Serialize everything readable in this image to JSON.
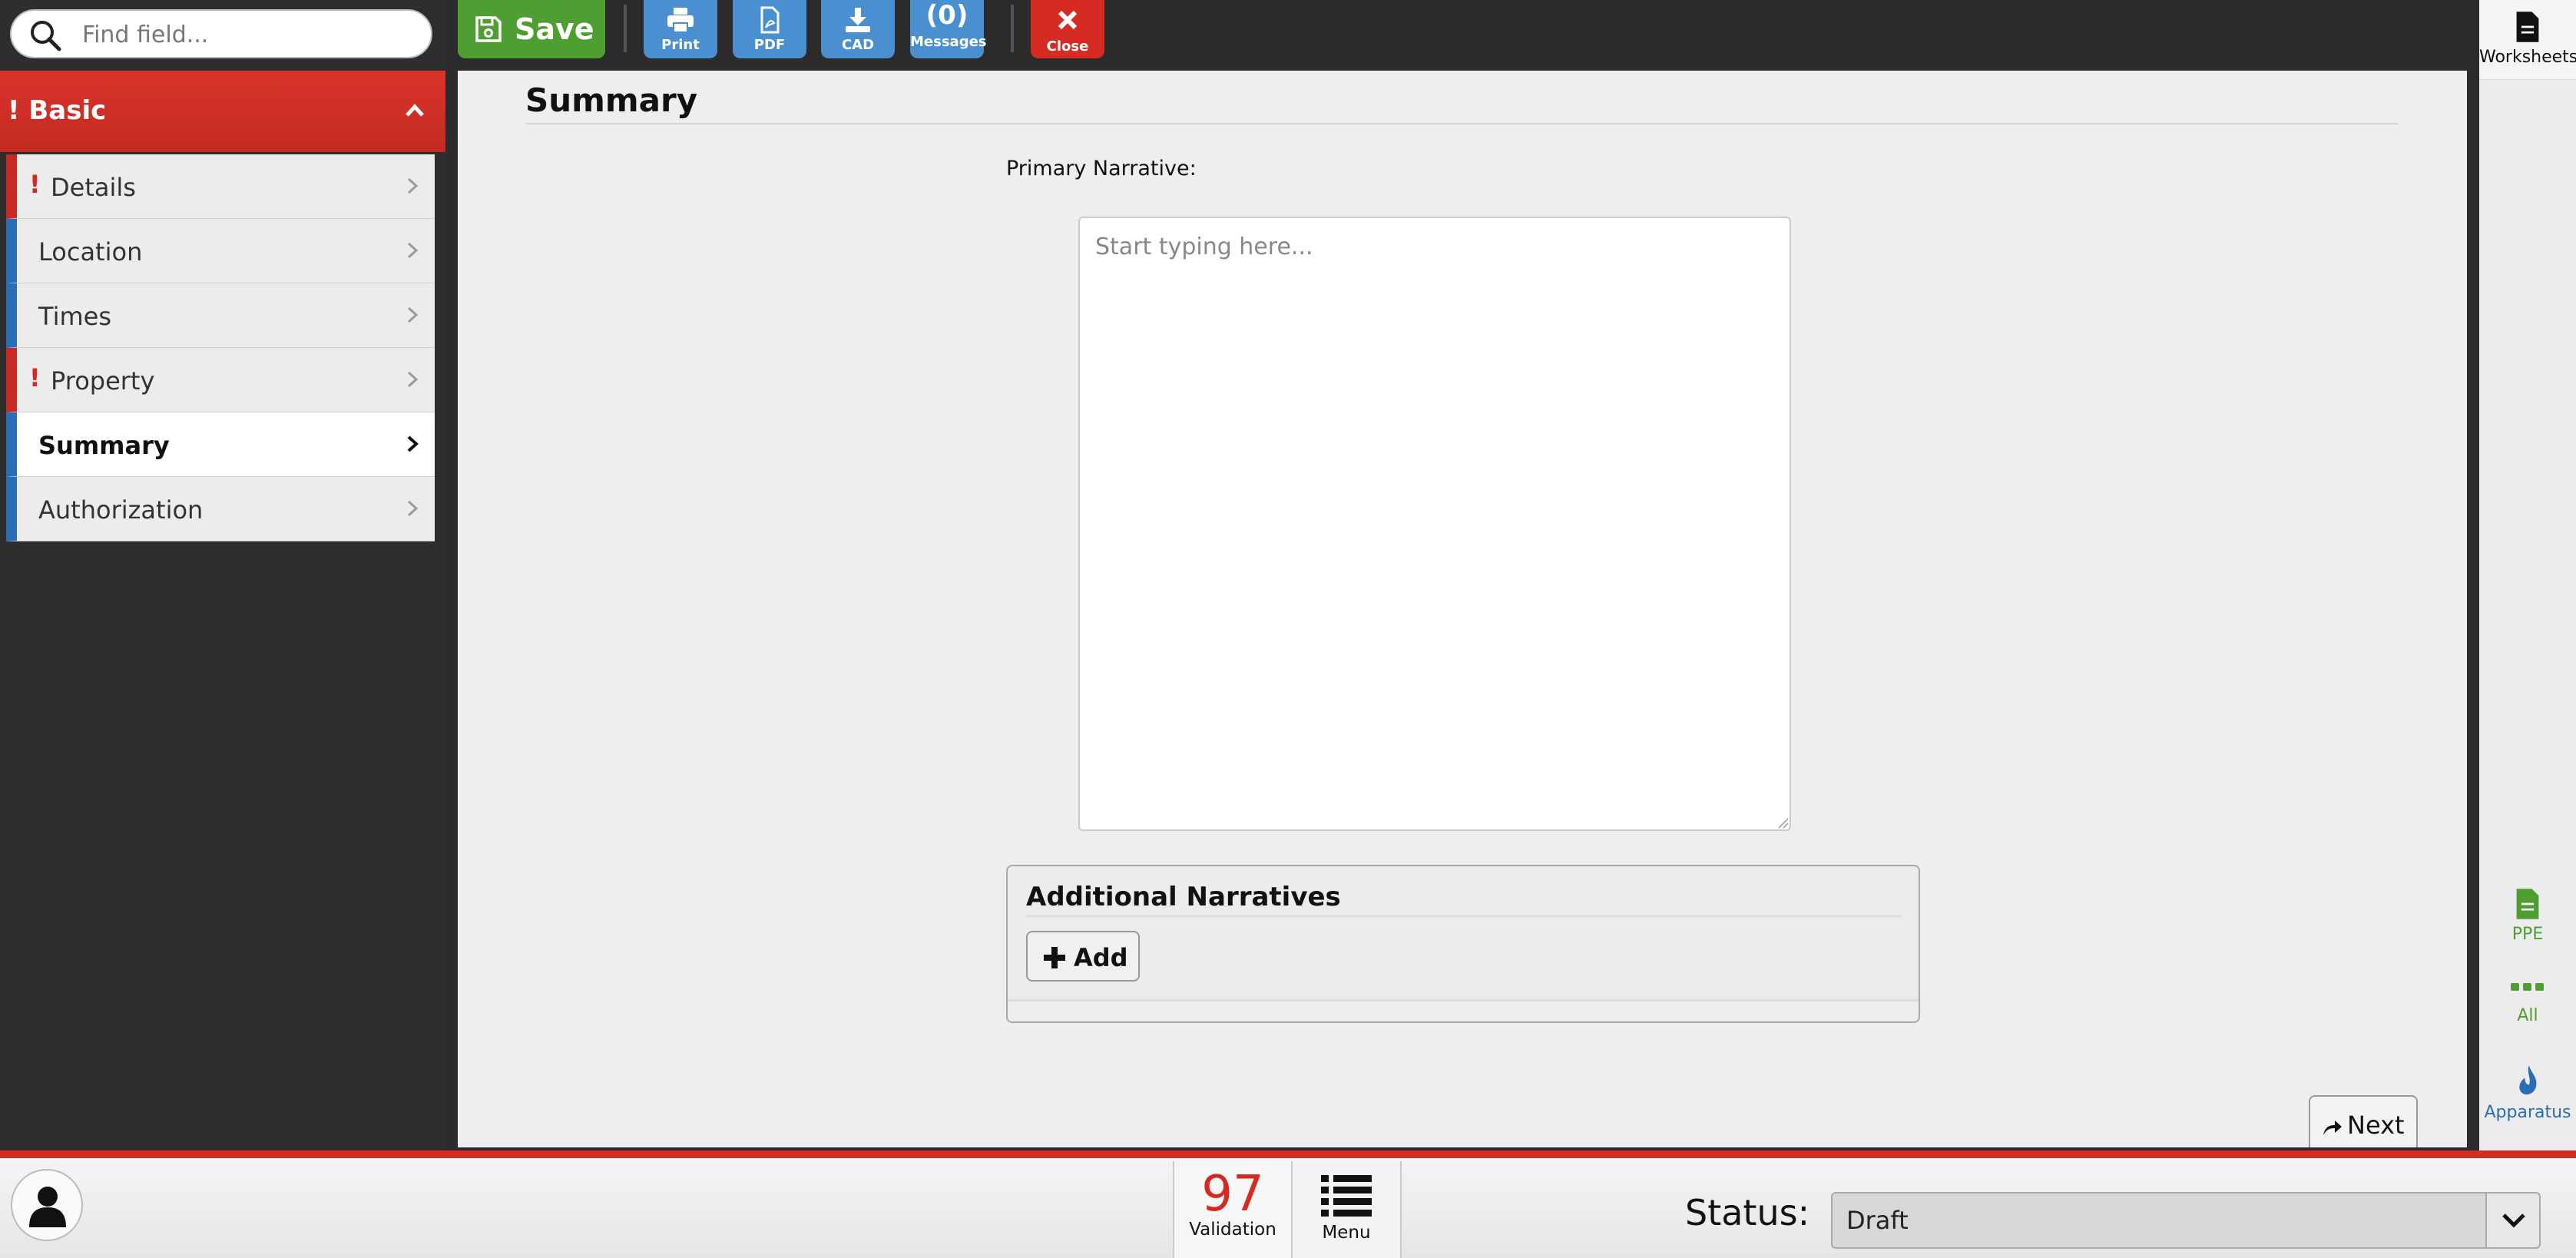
{
  "search": {
    "placeholder": "Find field..."
  },
  "section": {
    "title": "! Basic"
  },
  "nav": {
    "items": [
      {
        "label": "Details",
        "warning": true,
        "active": false
      },
      {
        "label": "Location",
        "warning": false,
        "active": false
      },
      {
        "label": "Times",
        "warning": false,
        "active": false
      },
      {
        "label": "Property",
        "warning": true,
        "active": false
      },
      {
        "label": "Summary",
        "warning": false,
        "active": true
      },
      {
        "label": "Authorization",
        "warning": false,
        "active": false
      }
    ],
    "warning_mark": "!"
  },
  "toolbar": {
    "save_label": "Save",
    "print_label": "Print",
    "pdf_label": "PDF",
    "cad_label": "CAD",
    "messages_count": "(0)",
    "messages_label": "Messages",
    "close_label": "Close"
  },
  "main": {
    "title": "Summary",
    "narrative_label": "Primary Narrative:",
    "narrative_placeholder": "Start typing here...",
    "narrative_value": "",
    "additional_title": "Additional Narratives",
    "add_label": "Add",
    "next_label": "Next"
  },
  "rail": {
    "worksheets": "Worksheets",
    "ppe": "PPE",
    "all": "All",
    "apparatus": "Apparatus"
  },
  "bottom": {
    "validation_count": "97",
    "validation_label": "Validation",
    "menu_label": "Menu",
    "status_label": "Status:",
    "status_value": "Draft"
  },
  "colors": {
    "accent_red": "#d62b22",
    "save_green": "#4f9e32",
    "toolbar_blue": "#4a8fcf",
    "nav_blue": "#2a6db5"
  }
}
